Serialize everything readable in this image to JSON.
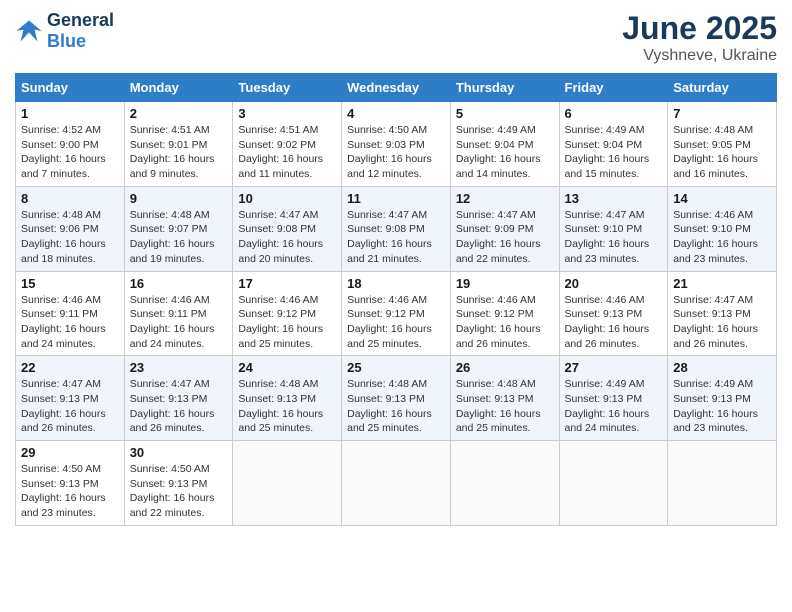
{
  "logo": {
    "line1": "General",
    "line2": "Blue"
  },
  "title": "June 2025",
  "subtitle": "Vyshneve, Ukraine",
  "weekdays": [
    "Sunday",
    "Monday",
    "Tuesday",
    "Wednesday",
    "Thursday",
    "Friday",
    "Saturday"
  ],
  "weeks": [
    [
      {
        "day": 1,
        "sunrise": "4:52 AM",
        "sunset": "9:00 PM",
        "daylight": "16 hours and 7 minutes."
      },
      {
        "day": 2,
        "sunrise": "4:51 AM",
        "sunset": "9:01 PM",
        "daylight": "16 hours and 9 minutes."
      },
      {
        "day": 3,
        "sunrise": "4:51 AM",
        "sunset": "9:02 PM",
        "daylight": "16 hours and 11 minutes."
      },
      {
        "day": 4,
        "sunrise": "4:50 AM",
        "sunset": "9:03 PM",
        "daylight": "16 hours and 12 minutes."
      },
      {
        "day": 5,
        "sunrise": "4:49 AM",
        "sunset": "9:04 PM",
        "daylight": "16 hours and 14 minutes."
      },
      {
        "day": 6,
        "sunrise": "4:49 AM",
        "sunset": "9:04 PM",
        "daylight": "16 hours and 15 minutes."
      },
      {
        "day": 7,
        "sunrise": "4:48 AM",
        "sunset": "9:05 PM",
        "daylight": "16 hours and 16 minutes."
      }
    ],
    [
      {
        "day": 8,
        "sunrise": "4:48 AM",
        "sunset": "9:06 PM",
        "daylight": "16 hours and 18 minutes."
      },
      {
        "day": 9,
        "sunrise": "4:48 AM",
        "sunset": "9:07 PM",
        "daylight": "16 hours and 19 minutes."
      },
      {
        "day": 10,
        "sunrise": "4:47 AM",
        "sunset": "9:08 PM",
        "daylight": "16 hours and 20 minutes."
      },
      {
        "day": 11,
        "sunrise": "4:47 AM",
        "sunset": "9:08 PM",
        "daylight": "16 hours and 21 minutes."
      },
      {
        "day": 12,
        "sunrise": "4:47 AM",
        "sunset": "9:09 PM",
        "daylight": "16 hours and 22 minutes."
      },
      {
        "day": 13,
        "sunrise": "4:47 AM",
        "sunset": "9:10 PM",
        "daylight": "16 hours and 23 minutes."
      },
      {
        "day": 14,
        "sunrise": "4:46 AM",
        "sunset": "9:10 PM",
        "daylight": "16 hours and 23 minutes."
      }
    ],
    [
      {
        "day": 15,
        "sunrise": "4:46 AM",
        "sunset": "9:11 PM",
        "daylight": "16 hours and 24 minutes."
      },
      {
        "day": 16,
        "sunrise": "4:46 AM",
        "sunset": "9:11 PM",
        "daylight": "16 hours and 24 minutes."
      },
      {
        "day": 17,
        "sunrise": "4:46 AM",
        "sunset": "9:12 PM",
        "daylight": "16 hours and 25 minutes."
      },
      {
        "day": 18,
        "sunrise": "4:46 AM",
        "sunset": "9:12 PM",
        "daylight": "16 hours and 25 minutes."
      },
      {
        "day": 19,
        "sunrise": "4:46 AM",
        "sunset": "9:12 PM",
        "daylight": "16 hours and 26 minutes."
      },
      {
        "day": 20,
        "sunrise": "4:46 AM",
        "sunset": "9:13 PM",
        "daylight": "16 hours and 26 minutes."
      },
      {
        "day": 21,
        "sunrise": "4:47 AM",
        "sunset": "9:13 PM",
        "daylight": "16 hours and 26 minutes."
      }
    ],
    [
      {
        "day": 22,
        "sunrise": "4:47 AM",
        "sunset": "9:13 PM",
        "daylight": "16 hours and 26 minutes."
      },
      {
        "day": 23,
        "sunrise": "4:47 AM",
        "sunset": "9:13 PM",
        "daylight": "16 hours and 26 minutes."
      },
      {
        "day": 24,
        "sunrise": "4:48 AM",
        "sunset": "9:13 PM",
        "daylight": "16 hours and 25 minutes."
      },
      {
        "day": 25,
        "sunrise": "4:48 AM",
        "sunset": "9:13 PM",
        "daylight": "16 hours and 25 minutes."
      },
      {
        "day": 26,
        "sunrise": "4:48 AM",
        "sunset": "9:13 PM",
        "daylight": "16 hours and 25 minutes."
      },
      {
        "day": 27,
        "sunrise": "4:49 AM",
        "sunset": "9:13 PM",
        "daylight": "16 hours and 24 minutes."
      },
      {
        "day": 28,
        "sunrise": "4:49 AM",
        "sunset": "9:13 PM",
        "daylight": "16 hours and 23 minutes."
      }
    ],
    [
      {
        "day": 29,
        "sunrise": "4:50 AM",
        "sunset": "9:13 PM",
        "daylight": "16 hours and 23 minutes."
      },
      {
        "day": 30,
        "sunrise": "4:50 AM",
        "sunset": "9:13 PM",
        "daylight": "16 hours and 22 minutes."
      },
      null,
      null,
      null,
      null,
      null
    ]
  ]
}
